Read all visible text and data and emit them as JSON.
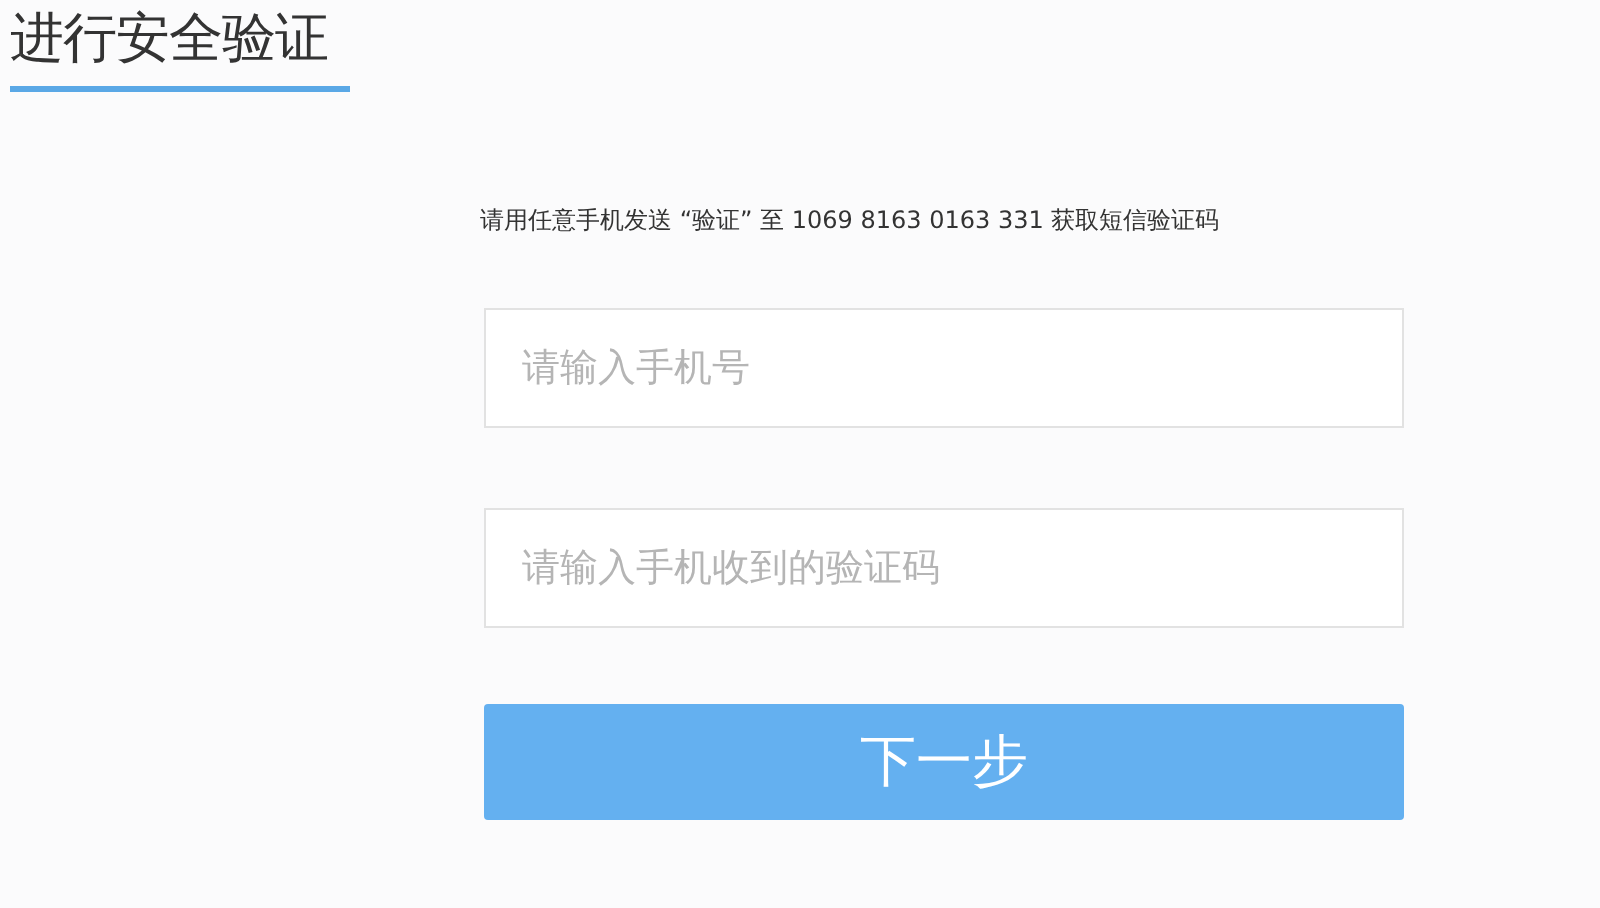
{
  "title": "进行安全验证",
  "instruction": "请用任意手机发送 “验证” 至 1069 8163 0163 331 获取短信验证码",
  "fields": [
    {
      "placeholder": "请输入手机号"
    },
    {
      "placeholder": "请输入手机收到的验证码"
    }
  ],
  "button": "下一步"
}
